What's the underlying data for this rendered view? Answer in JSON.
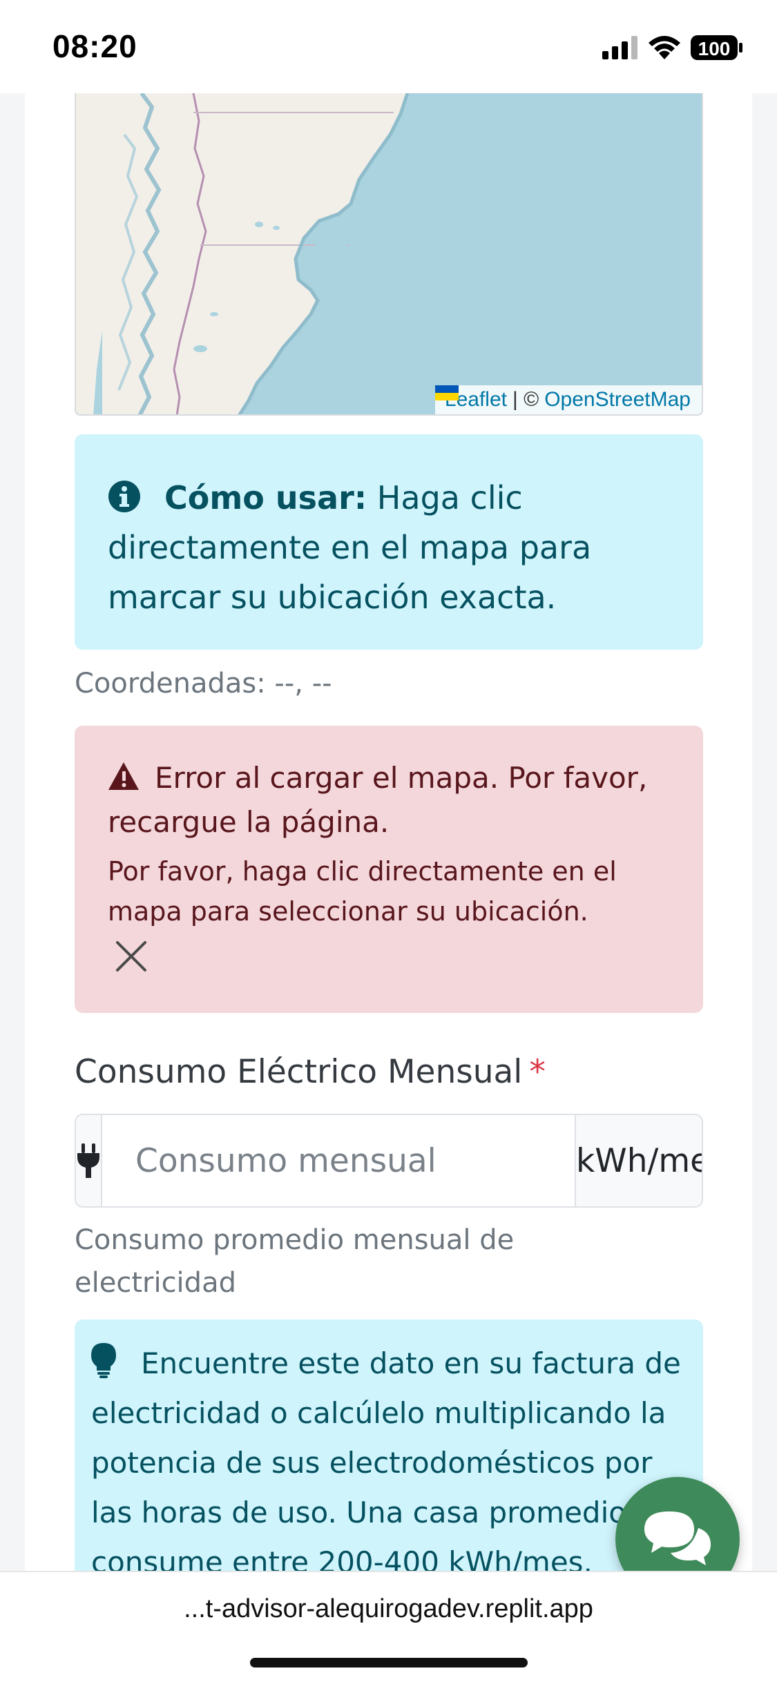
{
  "status_bar": {
    "time": "08:20",
    "battery": "100",
    "icons": [
      "signal-icon",
      "wifi-icon",
      "battery-icon"
    ]
  },
  "map": {
    "attribution_leaflet": "Leaflet",
    "attribution_sep": "| ©",
    "attribution_osm": "OpenStreetMap"
  },
  "info_alert": {
    "icon": "info-circle-icon",
    "bold": "Cómo usar:",
    "text": "Haga clic directamente en el mapa para marcar su ubicación exacta."
  },
  "coordinates": "Coordenadas: --, --",
  "error_alert": {
    "icon": "warning-triangle-icon",
    "title": "Error al cargar el mapa. Por favor, recargue la página.",
    "detail": "Por favor, haga clic directamente en el mapa para seleccionar su ubicación."
  },
  "consumption": {
    "label": "Consumo Eléctrico Mensual",
    "required": "*",
    "placeholder": "Consumo mensual",
    "unit": "kWh/mes",
    "help": "Consumo promedio mensual de electricidad",
    "icon": "plug-icon"
  },
  "tip_alert": {
    "icon": "lightbulb-icon",
    "text": "Encuentre este dato en su factura de electricidad o calcúlelo multiplicando la potencia de sus electrodomésticos por las horas de uso. Una casa promedio consume entre 200-400 kWh/mes."
  },
  "chat_button": {
    "icon": "chat-bubbles-icon"
  },
  "browser": {
    "url": "...t-advisor-alequirogadev.replit.app"
  },
  "colors": {
    "info_bg": "#cff4fc",
    "info_text": "#055160",
    "danger_bg": "#f3d7da",
    "danger_text": "#58151c",
    "required": "#dc3545",
    "chat_fab": "#3f8a5a",
    "sea": "#aad3df",
    "land": "#f2efe9"
  }
}
